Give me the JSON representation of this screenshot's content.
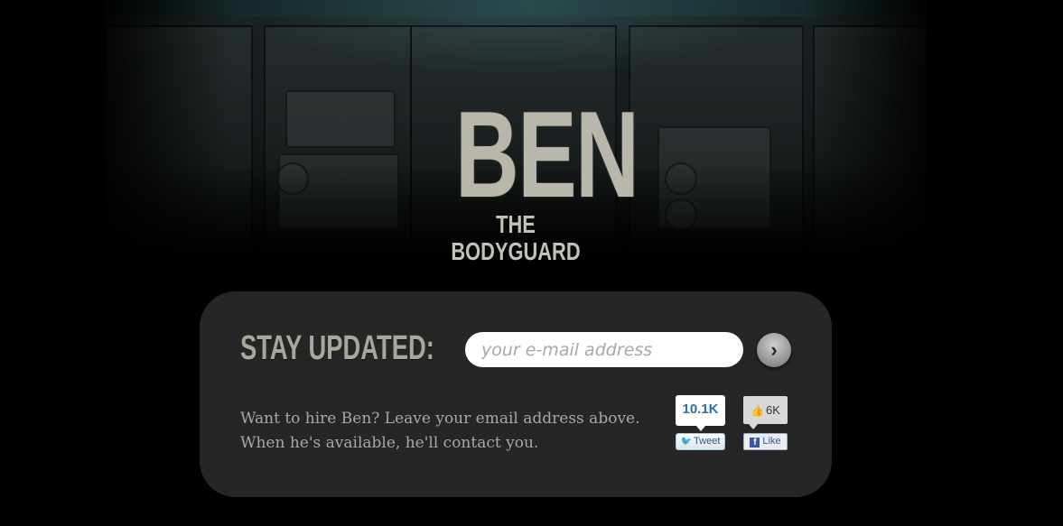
{
  "hero": {
    "logo_main": "BEN",
    "logo_sub": "THE BODYGUARD"
  },
  "signup": {
    "heading": "STAY UPDATED:",
    "email_placeholder": "your e-mail address",
    "submit_icon": "chevron-right-icon",
    "hire_line1": "Want to hire Ben? Leave your email address above.",
    "hire_line2": "When he's available, he'll contact you."
  },
  "social": {
    "tweet_count": "10.1K",
    "tweet_label": "Tweet",
    "like_count": "6K",
    "like_label": "Like"
  },
  "colors": {
    "background": "#000000",
    "panel": "#262626",
    "heading": "#a9a69b",
    "twitter_count": "#2f6f9a",
    "facebook": "#3b5998"
  }
}
